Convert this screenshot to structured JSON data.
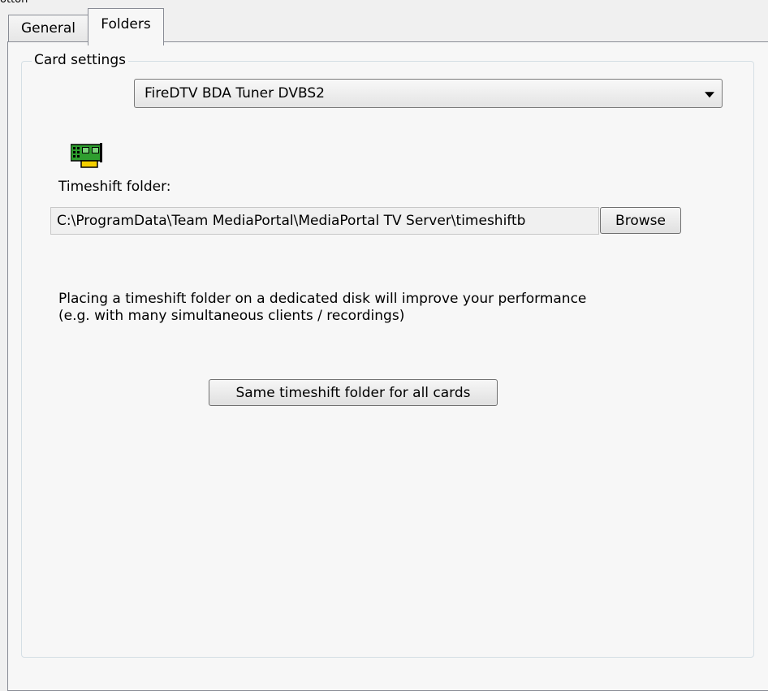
{
  "header_fragment": "otton",
  "tabs": [
    {
      "label": "General",
      "active": false
    },
    {
      "label": "Folders",
      "active": true
    }
  ],
  "group": {
    "title": "Card settings"
  },
  "card_select": {
    "icon": "tv-tuner-card-icon",
    "selected": "FireDTV BDA Tuner DVBS2"
  },
  "timeshift": {
    "label": "Timeshift folder:",
    "path": "C:\\ProgramData\\Team MediaPortal\\MediaPortal TV Server\\timeshiftb",
    "browse_label": "Browse"
  },
  "info": {
    "line1": "Placing a timeshift folder on a dedicated disk will improve your performance",
    "line2": "(e.g. with many simultaneous clients / recordings)"
  },
  "same_folder_button": "Same timeshift folder for all cards",
  "colors": {
    "panel_bg": "#f7f7f7",
    "window_bg": "#f0f0f0",
    "border": "#898c95",
    "icon_green": "#2e9e2e",
    "icon_yellow": "#f5d000"
  }
}
